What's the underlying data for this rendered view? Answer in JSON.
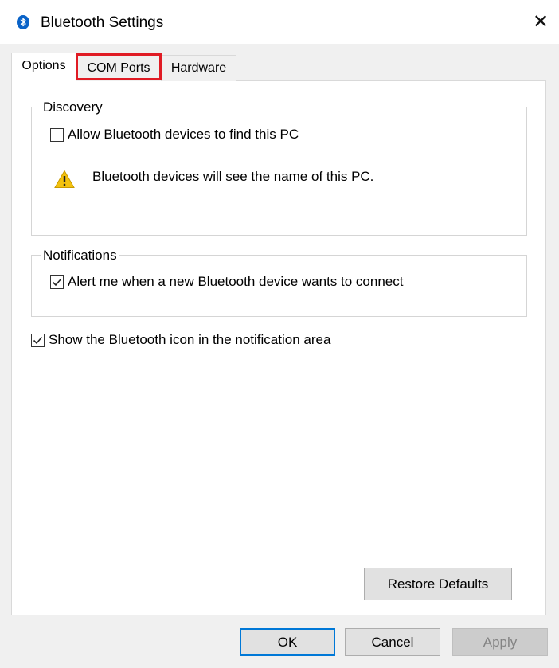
{
  "window": {
    "title": "Bluetooth Settings",
    "title_icon": "bluetooth-icon",
    "close_icon": "close-icon",
    "close_glyph": "✕"
  },
  "tabs": [
    {
      "label": "Options",
      "selected": true
    },
    {
      "label": "COM Ports",
      "selected": false,
      "highlighted": true
    },
    {
      "label": "Hardware",
      "selected": false
    }
  ],
  "discovery": {
    "group_label": "Discovery",
    "allow_label": "Allow Bluetooth devices to find this PC",
    "allow_checked": false,
    "warning_icon": "warning-icon",
    "warning_text": "Bluetooth devices will see the name of this PC."
  },
  "notifications": {
    "group_label": "Notifications",
    "alert_label": "Alert me when a new Bluetooth device wants to connect",
    "alert_checked": true
  },
  "show_icon": {
    "label": "Show the Bluetooth icon in the notification area",
    "checked": true
  },
  "buttons": {
    "restore": "Restore Defaults",
    "ok": "OK",
    "cancel": "Cancel",
    "apply": "Apply",
    "apply_enabled": false
  },
  "colors": {
    "highlight": "#e01b24",
    "focus_border": "#0078d7",
    "bluetooth_blue": "#0a63c8",
    "warning_yellow": "#f4c20d"
  }
}
